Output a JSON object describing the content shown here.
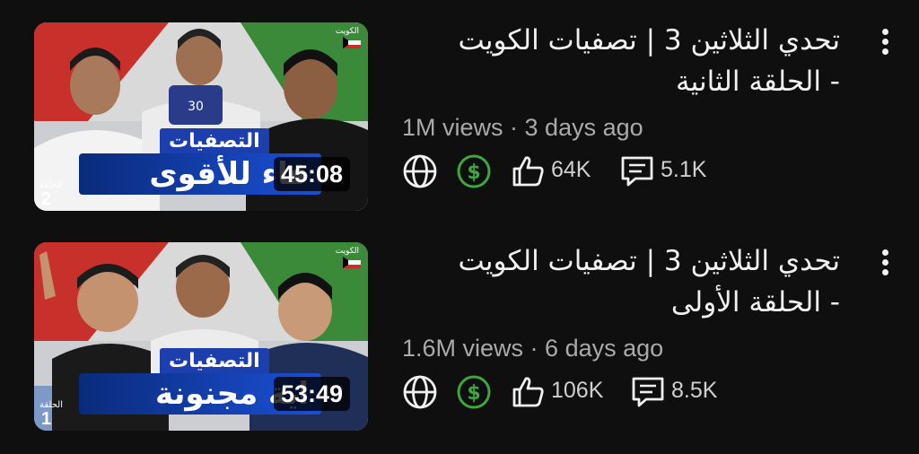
{
  "videos": [
    {
      "title_line1": "تحدي الثلاثين 3 | تصفيات الكويت",
      "title_line2": "- الحلقة الثانية",
      "views": "1M views",
      "age": "3 days ago",
      "likes": "64K",
      "comments": "5.1K",
      "duration": "45:08",
      "thumb_tag": "التصفيات",
      "thumb_caption": "قاء للأقوى",
      "thumb_badge_num": "2",
      "thumb_badge_label": "الحلقة",
      "thumb_flag_label": "الكويت",
      "thumb_logo_text": "30"
    },
    {
      "title_line1": "تحدي الثلاثين 3 | تصفيات الكويت",
      "title_line2": "- الحلقة الأولى",
      "views": "1.6M views",
      "age": "6 days ago",
      "likes": "106K",
      "comments": "8.5K",
      "duration": "53:49",
      "thumb_tag": "التصفيات",
      "thumb_caption": "اية مجنونة",
      "thumb_badge_num": "1",
      "thumb_badge_label": "الحلقة",
      "thumb_flag_label": "الكويت"
    }
  ],
  "meta_separator": " · ",
  "icons": [
    "globe-icon",
    "dollar-icon",
    "thumbs-up-icon",
    "comment-icon",
    "more-vert-icon"
  ],
  "colors": {
    "background": "#0f0f0f",
    "monetized_green": "#3ea63f",
    "meta_gray": "#aaaaaa"
  }
}
